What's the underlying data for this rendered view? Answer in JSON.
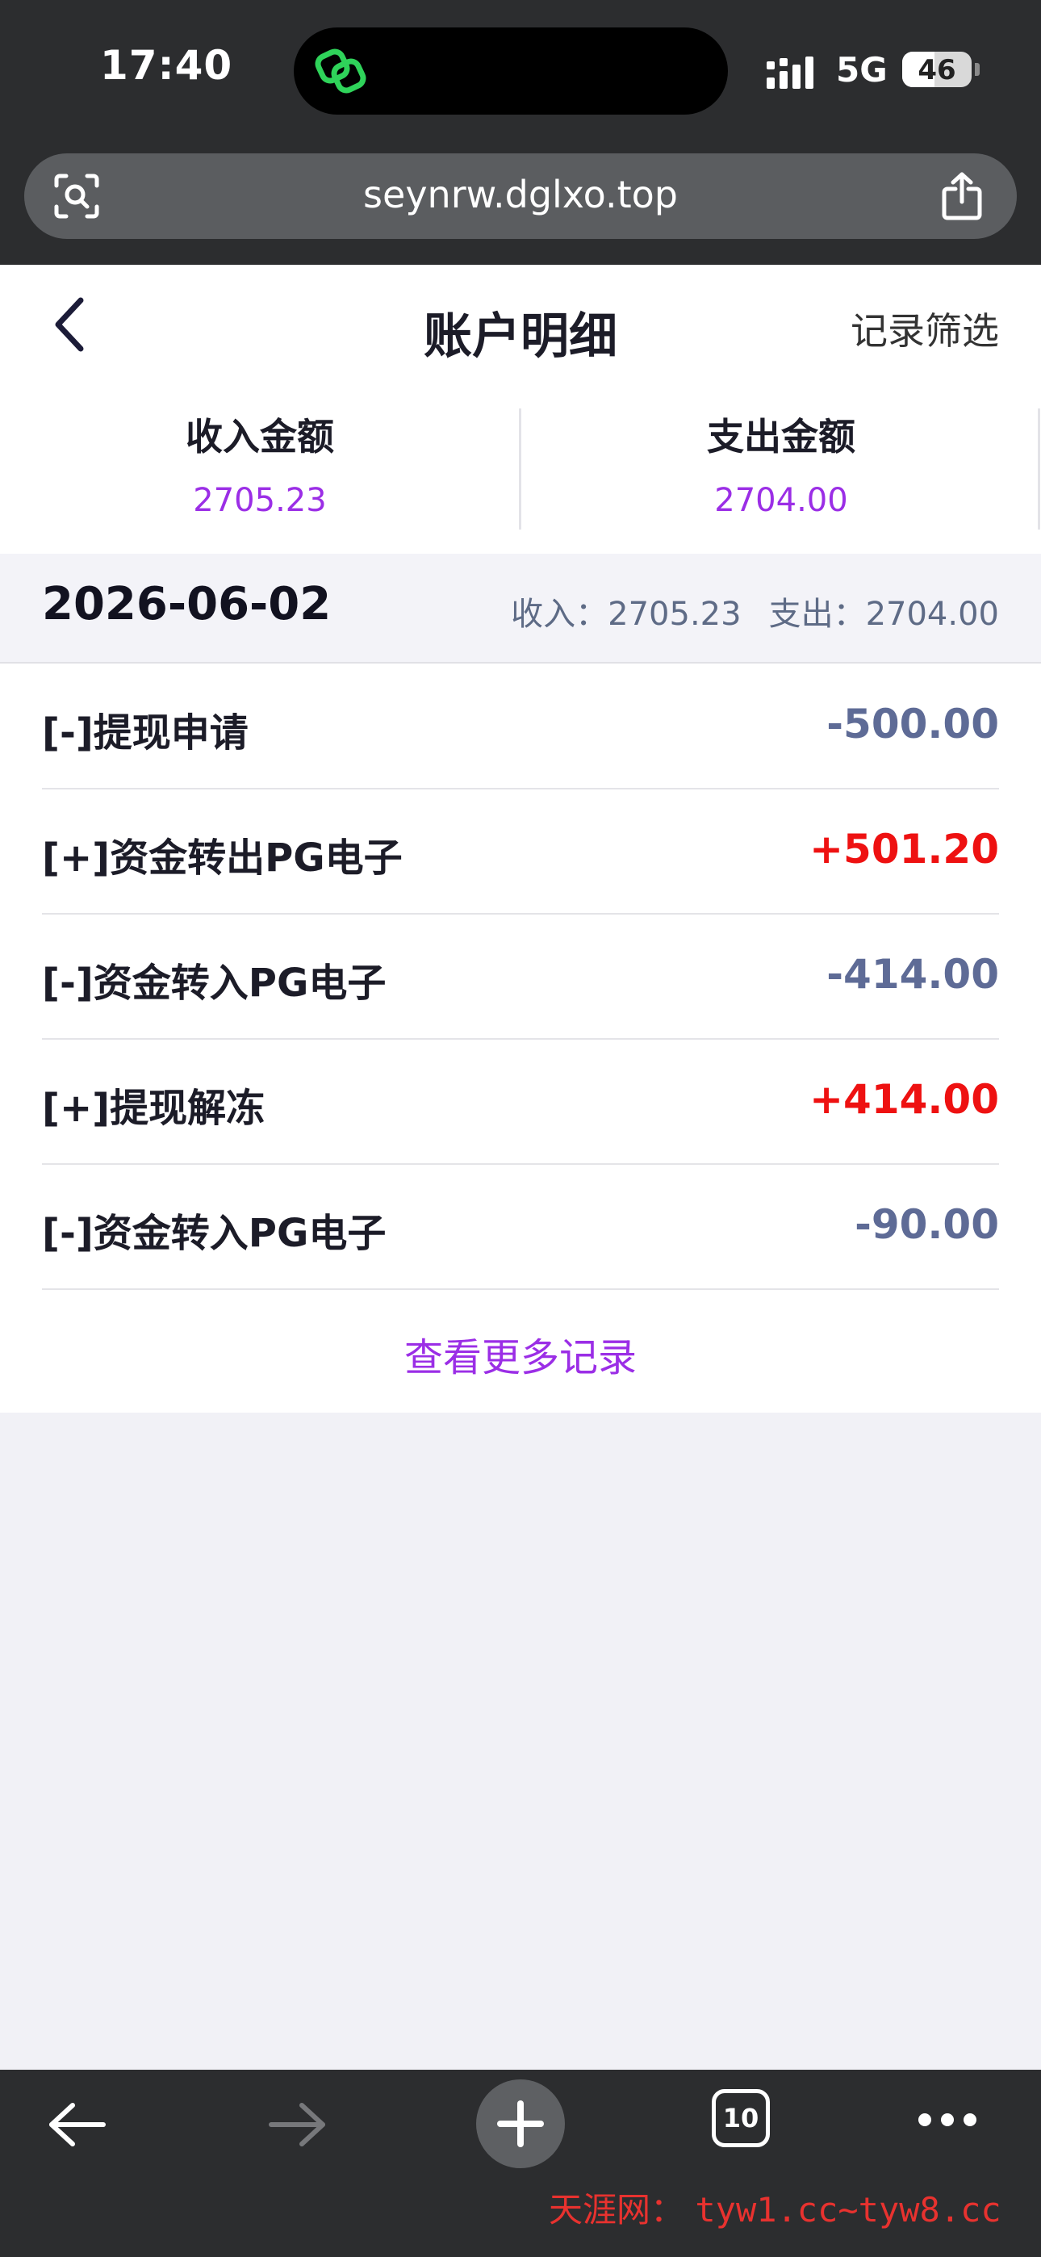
{
  "status_bar": {
    "time": "17:40",
    "network": "5G",
    "battery": "46",
    "battery_level": 0.46
  },
  "browser": {
    "url": "seynrw.dglxo.top",
    "tab_count": "10"
  },
  "header": {
    "title": "账户明细",
    "filter_label": "记录筛选"
  },
  "summary": {
    "income_label": "收入金额",
    "income_value": "2705.23",
    "expense_label": "支出金额",
    "expense_value": "2704.00"
  },
  "group": {
    "date": "2026-06-02",
    "income_text": "收入：2705.23",
    "expense_text": "支出：2704.00"
  },
  "records": [
    {
      "label": "[-]提现申请",
      "amount": "-500.00",
      "type": "negative"
    },
    {
      "label": "[+]资金转出PG电子",
      "amount": "+501.20",
      "type": "positive"
    },
    {
      "label": "[-]资金转入PG电子",
      "amount": "-414.00",
      "type": "negative"
    },
    {
      "label": "[+]提现解冻",
      "amount": "+414.00",
      "type": "positive"
    },
    {
      "label": "[-]资金转入PG电子",
      "amount": "-90.00",
      "type": "negative"
    }
  ],
  "more_label": "查看更多记录",
  "watermark": {
    "name": "天涯网：",
    "urls": "tyw1.cc~tyw8.cc"
  },
  "colors": {
    "accent": "#9b2ee6",
    "positive": "#ee1111",
    "negative": "#5e6b96"
  },
  "icons": {
    "island": "link-app-icon",
    "signal": "cell-signal-icon",
    "url_left": "visual-lookup-icon",
    "url_right": "share-icon",
    "back": "chevron-left-icon",
    "toolbar": [
      "arrow-left-icon",
      "arrow-right-icon",
      "plus-icon",
      "tabs-icon",
      "more-icon"
    ]
  }
}
